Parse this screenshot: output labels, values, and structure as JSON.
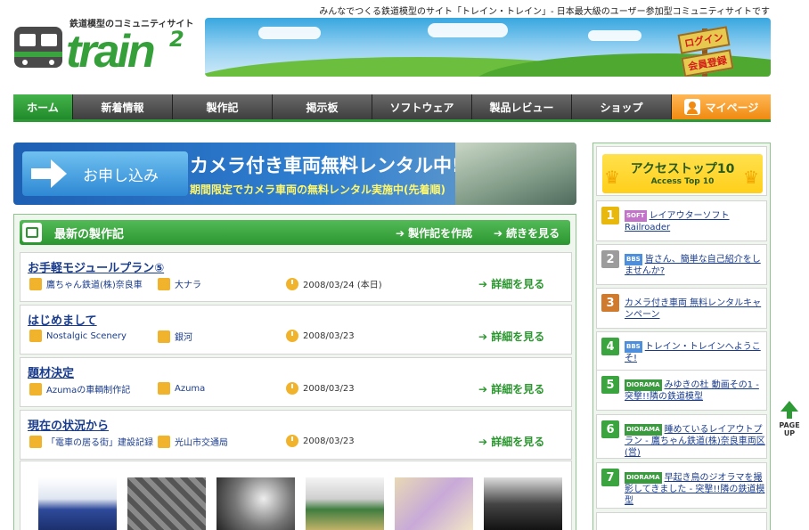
{
  "header": {
    "tagline": "みんなでつくる鉄道模型のサイト「トレイン・トレイン」- 日本最大級のユーザー参加型コミュニティサイトです",
    "logo_sub": "鉄道模型のコミュニティサイト",
    "logo_word": "train",
    "logo_sup": "2",
    "login_label": "ログイン",
    "register_label": "会員登録"
  },
  "nav": {
    "tabs": [
      {
        "label": "ホーム"
      },
      {
        "label": "新着情報"
      },
      {
        "label": "製作記"
      },
      {
        "label": "掲示板"
      },
      {
        "label": "ソフトウェア"
      },
      {
        "label": "製品レビュー"
      },
      {
        "label": "ショップ"
      },
      {
        "label": "マイページ"
      }
    ]
  },
  "banner": {
    "apply_label": "お申し込み",
    "headline": "カメラ付き車両無料レンタル中!",
    "subline": "期間限定でカメラ車両の無料レンタル実施中(先着順)"
  },
  "diary": {
    "title": "最新の製作記",
    "create_link": "製作記を作成",
    "continue_link": "続きを見る",
    "more_label": "詳細を見る",
    "entries": [
      {
        "title": "お手軽モジュールプラン⑤",
        "series": "鷹ちゃん鉄道(株)奈良車",
        "author": "大ナラ",
        "date": "2008/03/24 (本日)"
      },
      {
        "title": "はじめまして",
        "series": "Nostalgic Scenery",
        "author": "銀河",
        "date": "2008/03/23"
      },
      {
        "title": "題材決定",
        "series": "Azumaの車輌制作記",
        "author": "Azuma",
        "date": "2008/03/23"
      },
      {
        "title": "現在の状況から",
        "series": "「電車の居る街」建設記録",
        "author": "光山市交通局",
        "date": "2008/03/23"
      }
    ]
  },
  "access_top": {
    "title": "アクセストップ10",
    "subtitle": "Access Top 10",
    "items": [
      {
        "rank": "1",
        "category": "SOFT",
        "text": "レイアウターソフトRailroader"
      },
      {
        "rank": "2",
        "category": "BBS",
        "text": "皆さん、簡単な自己紹介をしませんか?"
      },
      {
        "rank": "3",
        "category": "",
        "text": "カメラ付き車両 無料レンタルキャンペーン"
      },
      {
        "rank": "4",
        "category": "BBS",
        "text": "トレイン・トレインへようこそ!"
      },
      {
        "rank": "5",
        "category": "DIORAMA",
        "text": "みゆきの杜 動画その1 - 突撃!!隣の鉄道模型"
      },
      {
        "rank": "6",
        "category": "DIORAMA",
        "text": "睡めているレイアウトプラン - 鷹ちゃん鉄道(株)奈良車両区(営)"
      },
      {
        "rank": "7",
        "category": "DIORAMA",
        "text": "早起き鳥のジオラマを撮影してきました - 突撃!!隣の鉄道模型"
      }
    ]
  },
  "pageup": {
    "label1": "PAGE",
    "label2": "UP"
  },
  "colors": {
    "brand_green": "#2e9a35",
    "nav_dark": "#3e3e3e",
    "mypage_orange": "#f08a10",
    "link_blue": "#1a3c8c"
  }
}
